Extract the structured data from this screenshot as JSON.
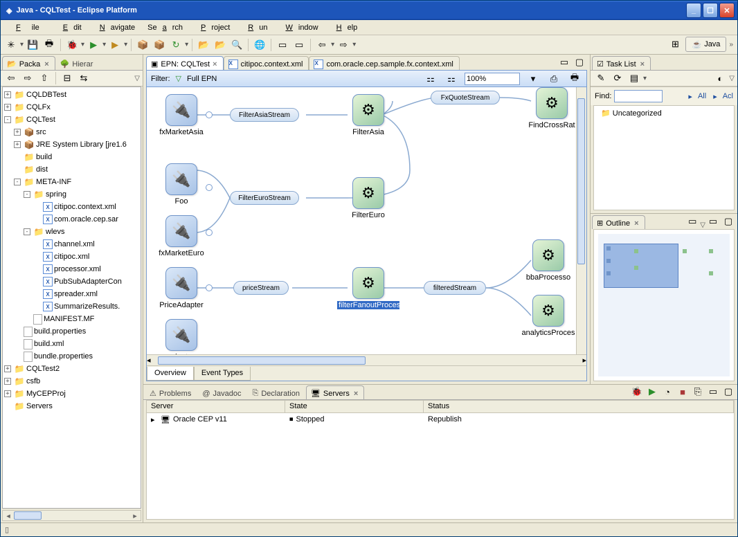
{
  "title": "Java - CQLTest - Eclipse Platform",
  "menu": [
    "File",
    "Edit",
    "Navigate",
    "Search",
    "Project",
    "Run",
    "Window",
    "Help"
  ],
  "perspective": "Java",
  "left_tabs": {
    "active": "Packa",
    "inactive": "Hierar"
  },
  "tree": [
    {
      "l": 0,
      "tw": "+",
      "ico": "proj",
      "t": "CQLDBTest"
    },
    {
      "l": 0,
      "tw": "+",
      "ico": "proj",
      "t": "CQLFx"
    },
    {
      "l": 0,
      "tw": "-",
      "ico": "proj",
      "t": "CQLTest"
    },
    {
      "l": 1,
      "tw": "+",
      "ico": "pkg",
      "t": "src"
    },
    {
      "l": 1,
      "tw": "+",
      "ico": "pkg",
      "t": "JRE System Library [jre1.6"
    },
    {
      "l": 1,
      "tw": "",
      "ico": "fold",
      "t": "build"
    },
    {
      "l": 1,
      "tw": "",
      "ico": "fold",
      "t": "dist"
    },
    {
      "l": 1,
      "tw": "-",
      "ico": "foldred",
      "t": "META-INF"
    },
    {
      "l": 2,
      "tw": "-",
      "ico": "foldred",
      "t": "spring"
    },
    {
      "l": 3,
      "tw": "",
      "ico": "xml",
      "t": "citipoc.context.xml"
    },
    {
      "l": 3,
      "tw": "",
      "ico": "xml",
      "t": "com.oracle.cep.sar"
    },
    {
      "l": 2,
      "tw": "-",
      "ico": "fold",
      "t": "wlevs"
    },
    {
      "l": 3,
      "tw": "",
      "ico": "xml",
      "t": "channel.xml"
    },
    {
      "l": 3,
      "tw": "",
      "ico": "xml",
      "t": "citipoc.xml"
    },
    {
      "l": 3,
      "tw": "",
      "ico": "xml",
      "t": "processor.xml"
    },
    {
      "l": 3,
      "tw": "",
      "ico": "xml",
      "t": "PubSubAdapterCon"
    },
    {
      "l": 3,
      "tw": "",
      "ico": "xml",
      "t": "spreader.xml"
    },
    {
      "l": 3,
      "tw": "",
      "ico": "xml",
      "t": "SummarizeResults."
    },
    {
      "l": 2,
      "tw": "",
      "ico": "file",
      "t": "MANIFEST.MF"
    },
    {
      "l": 1,
      "tw": "",
      "ico": "file",
      "t": "build.properties"
    },
    {
      "l": 1,
      "tw": "",
      "ico": "file",
      "t": "build.xml"
    },
    {
      "l": 1,
      "tw": "",
      "ico": "file",
      "t": "bundle.properties"
    },
    {
      "l": 0,
      "tw": "+",
      "ico": "proj",
      "t": "CQLTest2"
    },
    {
      "l": 0,
      "tw": "+",
      "ico": "proj",
      "t": "csfb"
    },
    {
      "l": 0,
      "tw": "+",
      "ico": "proj",
      "t": "MyCEPProj"
    },
    {
      "l": 0,
      "tw": "",
      "ico": "fold",
      "t": "Servers"
    }
  ],
  "editor_tabs": [
    {
      "label": "EPN: CQLTest",
      "active": true
    },
    {
      "label": "citipoc.context.xml",
      "active": false
    },
    {
      "label": "com.oracle.cep.sample.fx.context.xml",
      "active": false
    }
  ],
  "filter": {
    "label": "Filter:",
    "mode": "Full EPN",
    "zoom": "100%"
  },
  "nodes": {
    "fxMarketAsia": "fxMarketAsia",
    "foo": "Foo",
    "fxMarketEuro": "fxMarketEuro",
    "priceAdapter": "PriceAdapter",
    "adapter": "adapter",
    "filterAsia": "FilterAsia",
    "filterEuro": "FilterEuro",
    "filterFanout": "filterFanoutProcessor",
    "findCrossRat": "FindCrossRat",
    "bbaProcesso": "bbaProcesso",
    "analyticsProces": "analyticsProces"
  },
  "streams": {
    "filterAsiaStream": "FilterAsiaStream",
    "filterEuroStream": "FilterEuroStream",
    "priceStream": "priceStream",
    "filteredStream": "filteredStream",
    "fxQuoteStream": "FxQuoteStream"
  },
  "editor_bottom_tabs": [
    "Overview",
    "Event Types"
  ],
  "tasklist": {
    "title": "Task List",
    "find": "Find:",
    "all": "All",
    "acl": "Acl",
    "uncat": "Uncategorized"
  },
  "outline": {
    "title": "Outline"
  },
  "bottom_tabs": [
    "Problems",
    "Javadoc",
    "Declaration",
    "Servers"
  ],
  "servers": {
    "cols": [
      "Server",
      "State",
      "Status"
    ],
    "row": {
      "name": "Oracle CEP v11",
      "state": "Stopped",
      "status": "Republish"
    }
  }
}
